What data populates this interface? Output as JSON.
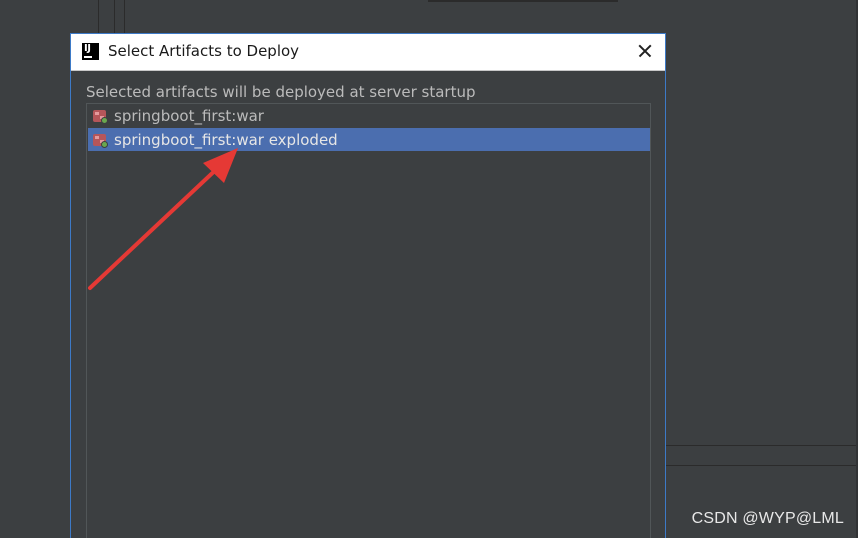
{
  "dialog": {
    "title": "Select Artifacts to Deploy",
    "app_icon_text": "IJ",
    "description": "Selected artifacts will be deployed at server startup",
    "artifacts": [
      {
        "label": "springboot_first:war",
        "selected": false
      },
      {
        "label": "springboot_first:war exploded",
        "selected": true
      }
    ]
  },
  "watermark": "CSDN @WYP@LML",
  "colors": {
    "selection": "#4b6eaf",
    "background": "#3c3f41",
    "annotation_arrow": "#e53935"
  },
  "icons": {
    "app": "intellij-idea-icon",
    "close": "close-icon",
    "artifact": "war-artifact-icon"
  }
}
